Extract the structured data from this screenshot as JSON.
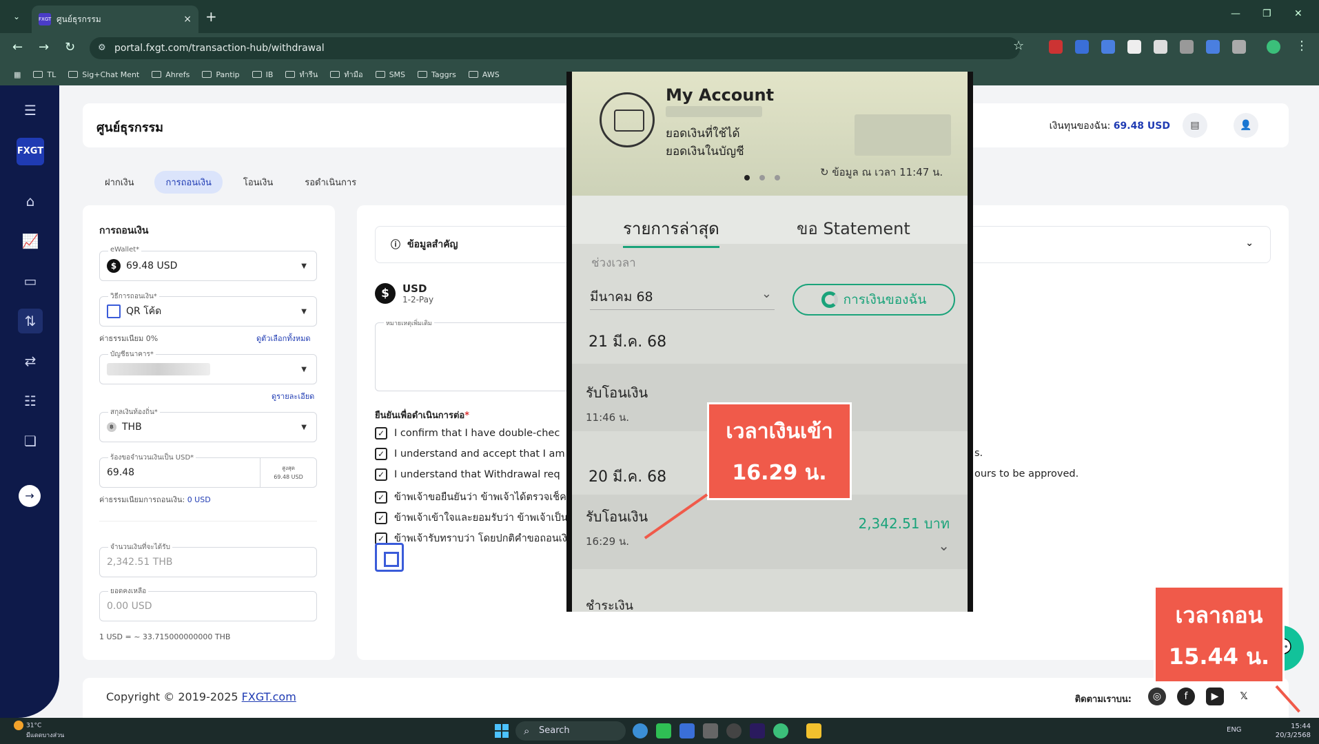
{
  "browser": {
    "tab_title": "ศูนย์ธุรกรรม",
    "tab_close": "×",
    "new_tab": "+",
    "url": "portal.fxgt.com/transaction-hub/withdrawal",
    "bookmarks": [
      "TL",
      "Sig+Chat Ment",
      "Ahrefs",
      "Pantip",
      "IB",
      "ทำรีน",
      "ทำมือ",
      "SMS",
      "Taggrs",
      "AWS"
    ]
  },
  "sidebar": {
    "logo": "FXGT"
  },
  "header": {
    "title": "ศูนย์ธุรกรรม",
    "balance_label": "เงินทุนของฉัน:",
    "balance_value": "69.48 USD"
  },
  "tabs": [
    "ฝากเงิน",
    "การถอนเงิน",
    "โอนเงิน",
    "รอดำเนินการ"
  ],
  "form": {
    "title": "การถอนเงิน",
    "ewallet_label": "eWallet*",
    "ewallet_value": "69.48 USD",
    "method_label": "วิธีการถอนเงิน*",
    "method_value": "QR โค้ด",
    "fee_text": "ค่าธรรมเนียม 0%",
    "see_all": "ดูตัวเลือกทั้งหมด",
    "bank_label": "บัญชีธนาคาร*",
    "details_link": "ดูรายละเอียด",
    "currency_label": "สกุลเงินท้องถิ่น*",
    "currency_value": "THB",
    "amount_label": "ร้องขอจำนวนเงินเป็น USD*",
    "amount_value": "69.48",
    "max_label": "สูงสุด",
    "max_value": "69.48 USD",
    "withdraw_fee_label": "ค่าธรรมเนียมการถอนเงิน:",
    "withdraw_fee_value": "0 USD",
    "receive_label": "จำนวนเงินที่จะได้รับ",
    "receive_value": "2,342.51 THB",
    "remaining_label": "ยอดคงเหลือ",
    "remaining_value": "0.00 USD",
    "rate": "1 USD = ~ 33.715000000000 THB"
  },
  "info": {
    "head": "ข้อมูลสำคัญ",
    "currency": "USD",
    "provider": "1-2-Pay",
    "note_label": "หมายเหตุเพิ่มเติม",
    "confirm_title": "ยืนยันเพื่อดำเนินการต่อ",
    "confirm_star": "*",
    "checks": [
      "I confirm that I have double-chec",
      "I understand and accept that I am",
      "I understand that Withdrawal req",
      "ข้าพเจ้าขอยืนยันว่า ข้าพเจ้าได้ตรวจเช็คข้",
      "ข้าพเจ้าเข้าใจและยอมรับว่า ข้าพเจ้าเป็นผู้",
      "ข้าพเจ้ารับทราบว่า โดยปกติคำขอถอนเงิน"
    ],
    "tail_1": "s.",
    "tail_2": "ours to be approved."
  },
  "footer": {
    "copyright": "Copyright © 2019-2025",
    "link": "FXGT.com",
    "follow": "ติดตามเราบน:"
  },
  "phone": {
    "account_title": "My Account",
    "line1": "ยอดเงินที่ใช้ได้",
    "line2": "ยอดเงินในบัญชี",
    "update": "ข้อมูล ณ เวลา 11:47 น.",
    "tab_recent": "รายการล่าสุด",
    "tab_statement": "ขอ Statement",
    "period_label": "ช่วงเวลา",
    "period_value": "มีนาคม 68",
    "my_money": "การเงินของฉัน",
    "date1": "21 มี.ค. 68",
    "row1_title": "รับโอนเงิน",
    "row1_time": "11:46 น.",
    "date2": "20 มี.ค. 68",
    "row2_title": "รับโอนเงิน",
    "row2_time": "16:29 น.",
    "row2_amount": "2,342.51 บาท",
    "row3_partial": "ชำระเงิน"
  },
  "annotations": {
    "a1_line1": "เวลาเงินเข้า",
    "a1_line2": "16.29 น.",
    "a2_line1": "เวลาถอน",
    "a2_line2": "15.44 น."
  },
  "taskbar": {
    "temp": "31°C",
    "weather": "มีแดดบางส่วน",
    "search": "Search",
    "lang": "ENG",
    "time": "15:44",
    "date": "20/3/2568"
  },
  "colors": {
    "accent": "#1f3bb3",
    "sidebar": "#0e1a4a",
    "green": "#12c29a",
    "annotation": "#f05a4a"
  }
}
